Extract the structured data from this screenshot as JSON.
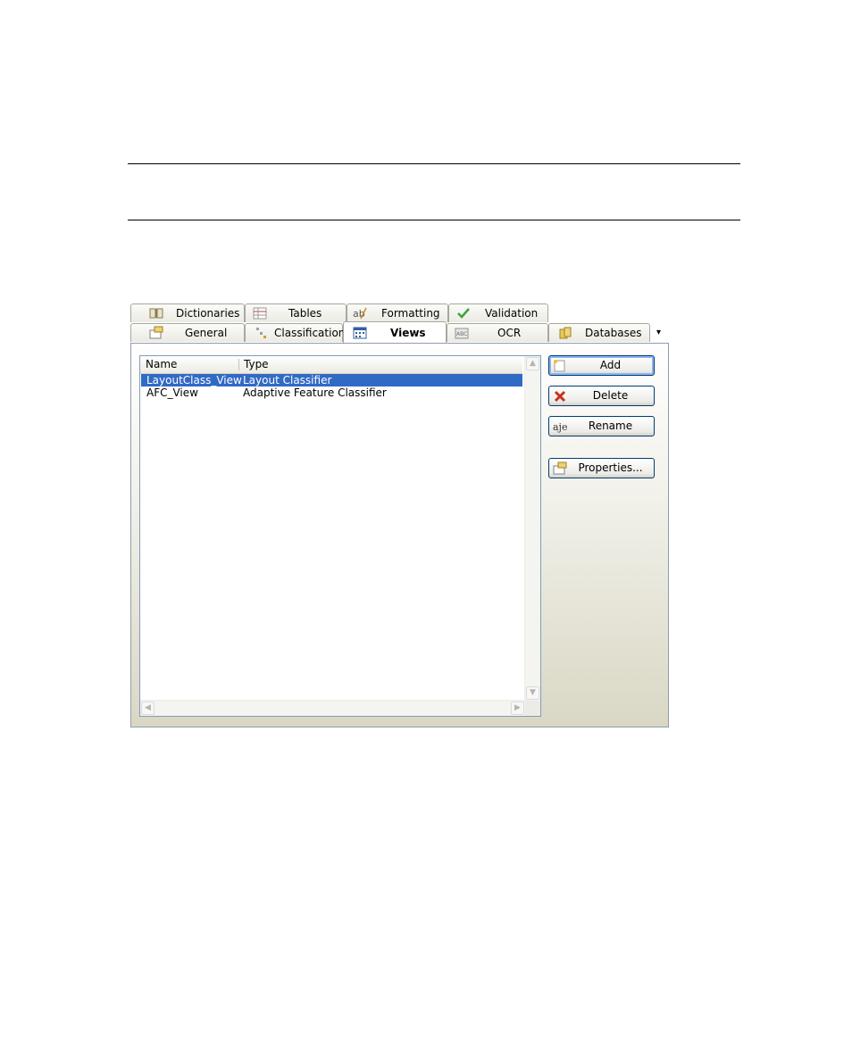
{
  "tabs_row1": [
    {
      "label": "Dictionaries",
      "icon": "book-icon"
    },
    {
      "label": "Tables",
      "icon": "table-icon"
    },
    {
      "label": "Formatting",
      "icon": "formatting-icon"
    },
    {
      "label": "Validation",
      "icon": "checkmark-icon"
    }
  ],
  "tabs_row2": [
    {
      "label": "General",
      "icon": "properties-icon"
    },
    {
      "label": "Classification",
      "icon": "classification-icon"
    },
    {
      "label": "Views",
      "icon": "views-icon",
      "active": true
    },
    {
      "label": "OCR",
      "icon": "ocr-icon"
    },
    {
      "label": "Databases",
      "icon": "database-icon"
    }
  ],
  "more_tabs_glyph": "▾",
  "list": {
    "columns": [
      "Name",
      "Type"
    ],
    "rows": [
      {
        "name": "LayoutClass_View",
        "type": "Layout Classifier",
        "selected": true
      },
      {
        "name": "AFC_View",
        "type": "Adaptive Feature Classifier",
        "selected": false
      }
    ]
  },
  "buttons": {
    "add": "Add",
    "delete": "Delete",
    "rename": "Rename",
    "properties": "Properties..."
  },
  "colors": {
    "selection": "#316ac5",
    "panel_border": "#8f9db0",
    "button_border": "#003c74"
  }
}
